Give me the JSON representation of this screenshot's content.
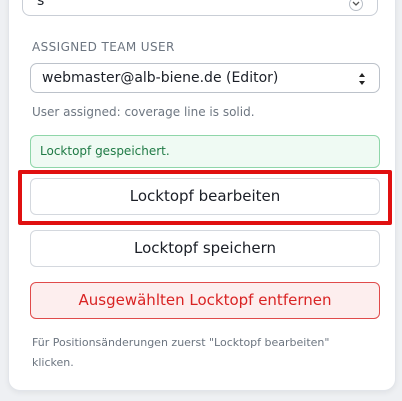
{
  "top_select": {
    "value": "s"
  },
  "assigned": {
    "label": "ASSIGNED TEAM USER",
    "selected_user": "webmaster@alb-biene.de (Editor)",
    "hint": "User assigned: coverage line is solid."
  },
  "toast": {
    "message": "Locktopf gespeichert."
  },
  "buttons": {
    "edit": "Locktopf bearbeiten",
    "save": "Locktopf speichern",
    "remove": "Ausgewählten Locktopf entfernen"
  },
  "footnote": "Für Positionsänderungen zuerst \"Locktopf bearbeiten\" klicken.",
  "colors": {
    "highlight": "#e01010",
    "success_bg": "#effaf3",
    "success_border": "#8fd6a9",
    "danger": "#d92323"
  },
  "icons": {
    "top_select": "chevron-down-icon",
    "user_select": "select-arrows-icon"
  }
}
